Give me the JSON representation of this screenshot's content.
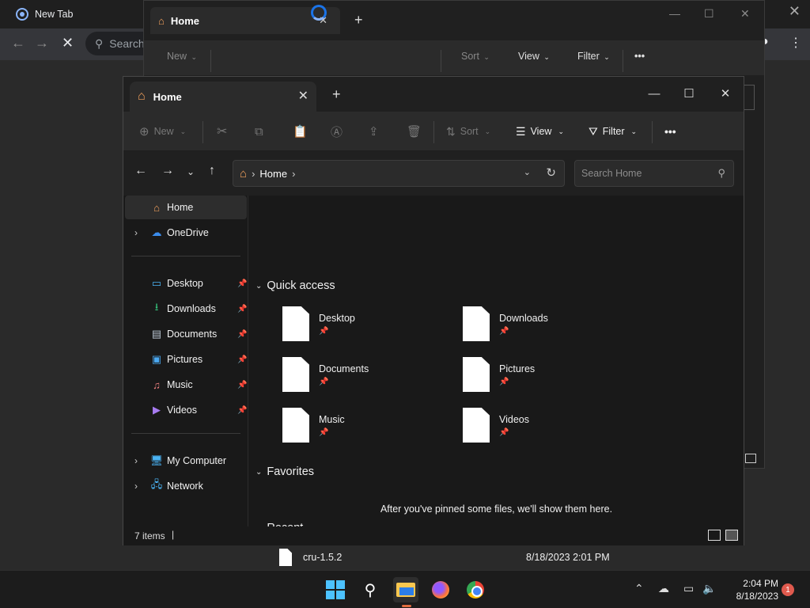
{
  "browser": {
    "tab_title": "New Tab",
    "search_placeholder": "Search"
  },
  "bg_window": {
    "tab_title": "Home",
    "toolbar": {
      "new": "New",
      "sort": "Sort",
      "view": "View",
      "filter": "Filter",
      "more": "•••"
    }
  },
  "window": {
    "tab_title": "Home",
    "toolbar": {
      "new": "New",
      "sort": "Sort",
      "view": "View",
      "filter": "Filter",
      "more": "•••"
    },
    "address": {
      "crumb": "Home"
    },
    "search_placeholder": "Search Home",
    "sidebar": {
      "home": "Home",
      "onedrive": "OneDrive",
      "pinned": [
        {
          "label": "Desktop",
          "icon": "desktop-icon"
        },
        {
          "label": "Downloads",
          "icon": "downloads-icon"
        },
        {
          "label": "Documents",
          "icon": "documents-icon"
        },
        {
          "label": "Pictures",
          "icon": "pictures-icon"
        },
        {
          "label": "Music",
          "icon": "music-icon"
        },
        {
          "label": "Videos",
          "icon": "videos-icon"
        }
      ],
      "my_computer": "My Computer",
      "network": "Network"
    },
    "sections": {
      "quick_access": "Quick access",
      "favorites": "Favorites",
      "recent": "Recent"
    },
    "quick_access_items": [
      "Desktop",
      "Downloads",
      "Documents",
      "Pictures",
      "Music",
      "Videos"
    ],
    "favorites_empty": "After you've pinned some files, we'll show them here.",
    "recent_items": [
      {
        "name": "cru-1.5.2",
        "date": "8/18/2023 2:01 PM"
      }
    ],
    "status": "7 items"
  },
  "taskbar": {
    "time": "2:04 PM",
    "date": "8/18/2023",
    "notification_count": "1"
  },
  "colors": {
    "accent": "#4cc2ff",
    "home_icon": "#f5a25d"
  }
}
